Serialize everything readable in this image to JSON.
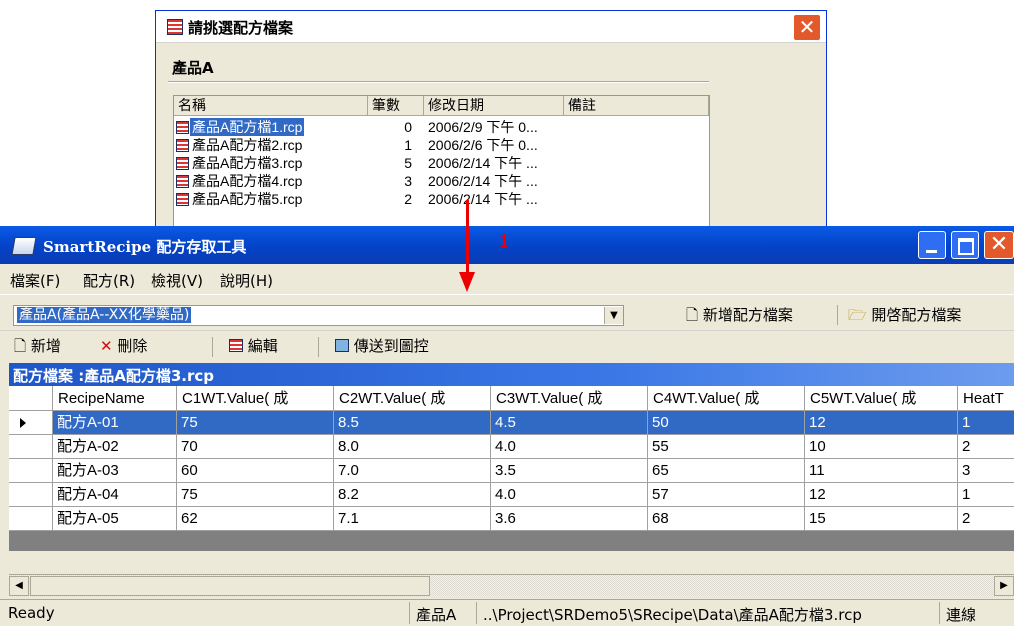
{
  "dialog": {
    "title": "請挑選配方檔案",
    "product": "產品A",
    "columns": [
      "名稱",
      "筆數",
      "修改日期",
      "備註"
    ],
    "files": [
      {
        "name": "產品A配方檔1.rcp",
        "count": "0",
        "date": "2006/2/9 下午 0...",
        "selected": true
      },
      {
        "name": "產品A配方檔2.rcp",
        "count": "1",
        "date": "2006/2/6 下午 0...",
        "selected": false
      },
      {
        "name": "產品A配方檔3.rcp",
        "count": "5",
        "date": "2006/2/14 下午 ...",
        "selected": false
      },
      {
        "name": "產品A配方檔4.rcp",
        "count": "3",
        "date": "2006/2/14 下午 ...",
        "selected": false
      },
      {
        "name": "產品A配方檔5.rcp",
        "count": "2",
        "date": "2006/2/14 下午 ...",
        "selected": false
      }
    ]
  },
  "window": {
    "title": "SmartRecipe 配方存取工具",
    "close_glyph": "✕"
  },
  "menu": [
    "檔案(F)",
    "配方(R)",
    "檢視(V)",
    "說明(H)"
  ],
  "toolbar1": {
    "product_select": "產品A(產品A--XX化學藥品)",
    "new_file": "新增配方檔案",
    "open_file": "開啓配方檔案"
  },
  "toolbar2": {
    "new": "新增",
    "delete": "刪除",
    "edit": "編輯",
    "send": "傳送到圖控"
  },
  "caption": "配方檔案 :產品A配方檔3.rcp",
  "grid": {
    "columns": [
      "RecipeName",
      "C1WT.Value( 成",
      "C2WT.Value( 成",
      "C3WT.Value( 成",
      "C4WT.Value( 成",
      "C5WT.Value( 成",
      "HeatT"
    ],
    "rows": [
      [
        "配方A-01",
        "75",
        "8.5",
        "4.5",
        "50",
        "12",
        "1"
      ],
      [
        "配方A-02",
        "70",
        "8.0",
        "4.0",
        "55",
        "10",
        "2"
      ],
      [
        "配方A-03",
        "60",
        "7.0",
        "3.5",
        "65",
        "11",
        "3"
      ],
      [
        "配方A-04",
        "75",
        "8.2",
        "4.0",
        "57",
        "12",
        "1"
      ],
      [
        "配方A-05",
        "62",
        "7.1",
        "3.6",
        "68",
        "15",
        "2"
      ]
    ],
    "selected_row": 0
  },
  "status": {
    "state": "Ready",
    "product": "產品A",
    "path": "..\\Project\\SRDemo5\\SRecipe\\Data\\產品A配方檔3.rcp",
    "connection": "連線"
  },
  "annotation": "1",
  "colors": {
    "titlebar": "#0a5ae6",
    "selection": "#316ac5",
    "annotation": "#e00000",
    "close": "#e25a2c"
  }
}
